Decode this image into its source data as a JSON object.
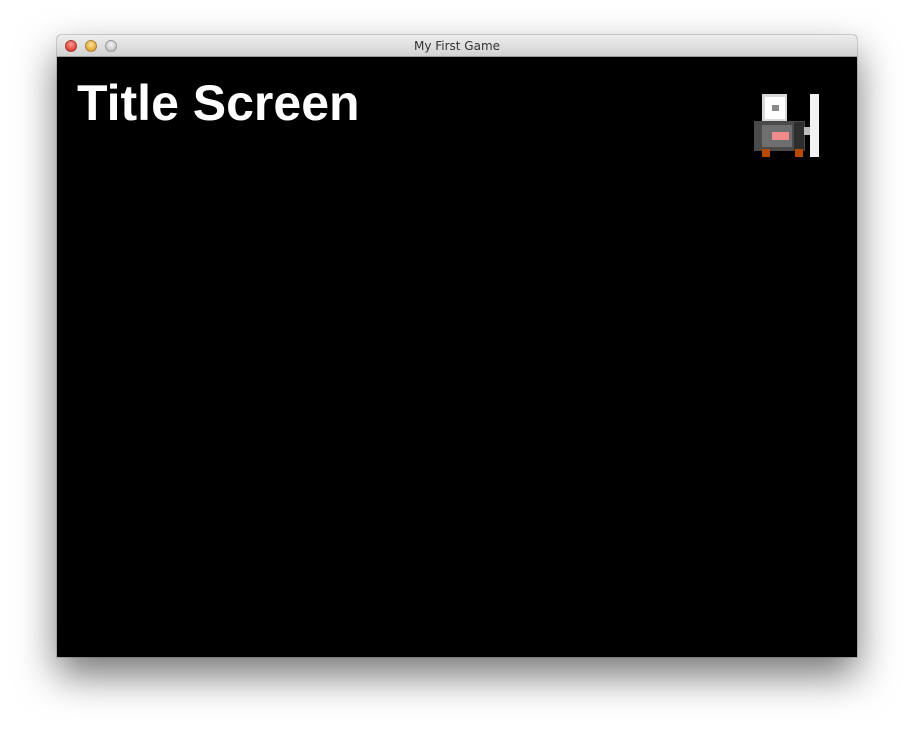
{
  "window": {
    "title": "My First Game",
    "controls": [
      "close-button",
      "minimize-button",
      "zoom-button"
    ]
  },
  "screen": {
    "heading": "Title Screen",
    "sprite": {
      "icon": "pixel-knight-sprite",
      "colors": {
        "helmet": "#e8e8e8",
        "armor_dark": "#4a4a4a",
        "armor_mid": "#7a7a7a",
        "face": "#f28c8c",
        "boots": "#b84a00",
        "sword": "#f2f2f2"
      }
    },
    "background": "#000000"
  }
}
